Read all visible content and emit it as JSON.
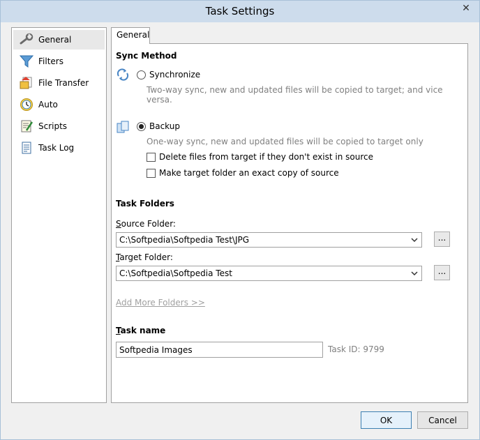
{
  "window": {
    "title": "Task Settings",
    "close_glyph": "✕"
  },
  "sidebar": {
    "items": [
      {
        "label": "General",
        "icon": "wrench-icon"
      },
      {
        "label": "Filters",
        "icon": "funnel-icon"
      },
      {
        "label": "File Transfer",
        "icon": "file-transfer-icon"
      },
      {
        "label": "Auto",
        "icon": "clock-icon"
      },
      {
        "label": "Scripts",
        "icon": "script-icon"
      },
      {
        "label": "Task Log",
        "icon": "log-icon"
      }
    ]
  },
  "tab": {
    "label": "General"
  },
  "sync": {
    "title": "Sync Method",
    "synchronize": {
      "label": "Synchronize",
      "hint": "Two-way sync, new and updated files will be copied to target; and vice versa.",
      "checked": false
    },
    "backup": {
      "label": "Backup",
      "hint": "One-way sync, new and updated files will be copied to target only",
      "checked": true
    },
    "delete_files": {
      "label": "Delete files from target if they don't exist in source",
      "checked": false
    },
    "exact_copy": {
      "label": "Make target folder an exact copy of source",
      "checked": false
    }
  },
  "folders": {
    "title": "Task Folders",
    "source_label_first": "S",
    "source_label_rest": "ource Folder:",
    "source_value": "C:\\Softpedia\\Softpedia Test\\JPG",
    "target_label_first": "T",
    "target_label_rest": "arget Folder:",
    "target_value": "C:\\Softpedia\\Softpedia Test",
    "browse_label": "...",
    "add_more": "Add More Folders >>"
  },
  "task": {
    "name_label_first": "T",
    "name_label_rest": "ask name",
    "name_value": "Softpedia Images",
    "task_id": "Task ID: 9799"
  },
  "footer": {
    "ok": "OK",
    "cancel": "Cancel"
  },
  "colors": {
    "titlebar": "#cddcec",
    "accent": "#3c7fb1"
  }
}
